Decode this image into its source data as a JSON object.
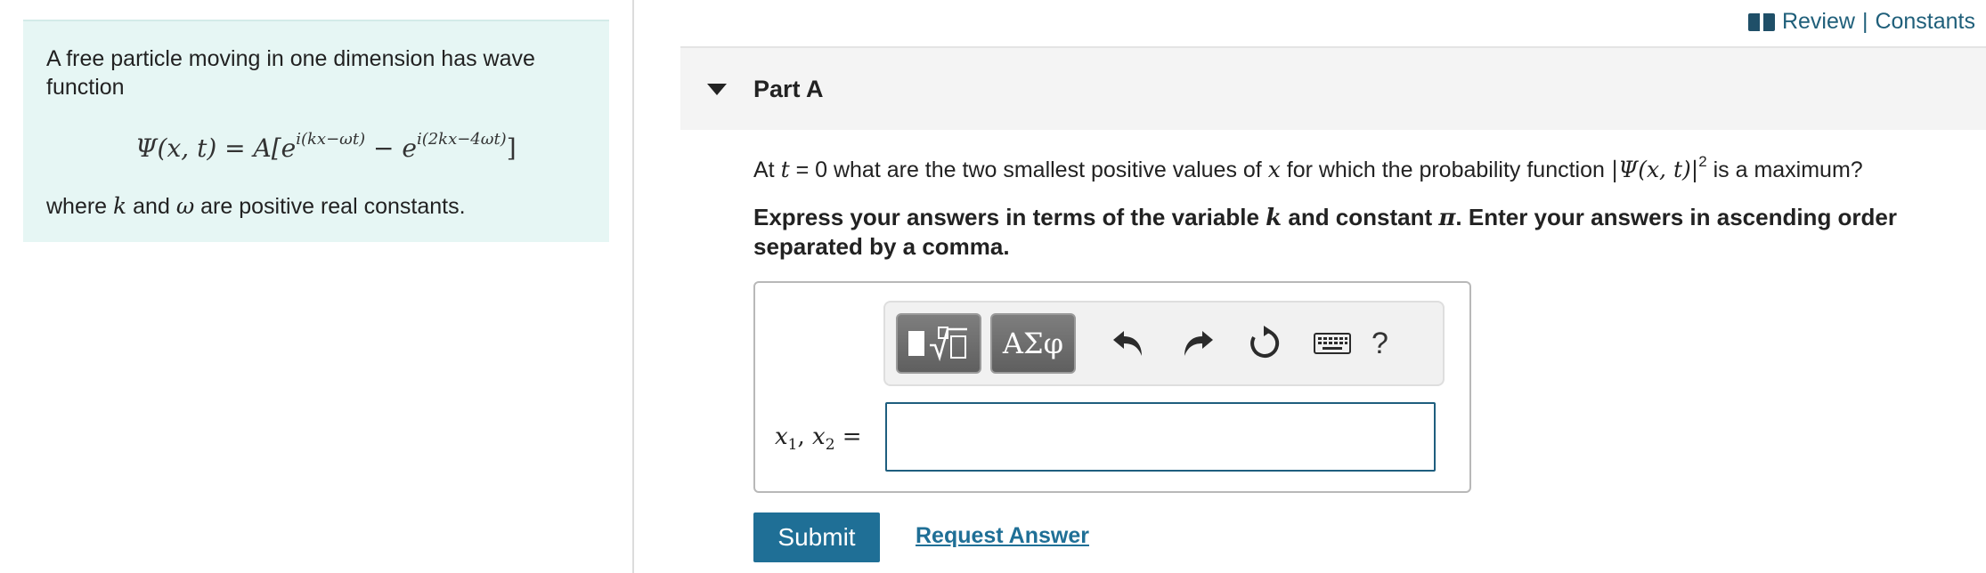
{
  "problem": {
    "intro": "A free particle moving in one dimension has wave function",
    "equation": {
      "lhs": "Ψ(x, t) = A[e",
      "exp1": "i(kx−ωt)",
      "mid": " − e",
      "exp2": "i(2kx−4ωt)",
      "rhs": "]"
    },
    "where": {
      "w1": "where ",
      "k": "k",
      "w2": " and ",
      "omega": "ω",
      "w3": " are positive real constants."
    }
  },
  "header": {
    "review": "Review",
    "sep": " | ",
    "constants": "Constants"
  },
  "part": {
    "title": "Part A"
  },
  "question": {
    "p1": "At ",
    "t": "t",
    "p2": " = 0 what are the two smallest positive values of ",
    "x": "x",
    "p3": " for which the probability function ",
    "psi": "|Ψ(x, t)|",
    "sup": "2",
    "p4": " is a maximum?"
  },
  "instructions": {
    "p1": "Express your answers in terms of the variable ",
    "k": "k",
    "p2": " and constant ",
    "pi": "π",
    "p3": ". Enter your answers in ascending order separated by a comma."
  },
  "toolbar": {
    "greek_label": "ΑΣφ",
    "help_label": "?"
  },
  "answer": {
    "var1": "x",
    "sub1": "1",
    "comma": ", ",
    "var2": "x",
    "sub2": "2",
    "eq": " =",
    "value": "",
    "placeholder": ""
  },
  "actions": {
    "submit": "Submit",
    "request": "Request Answer"
  },
  "colors": {
    "accent": "#1f6f96",
    "panel": "#e6f6f4"
  }
}
